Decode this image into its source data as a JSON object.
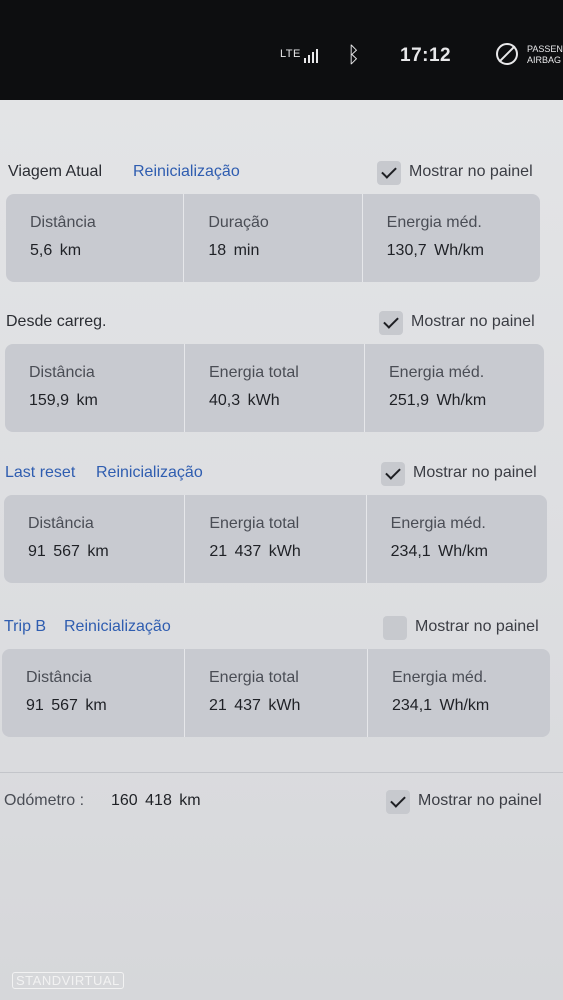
{
  "status_bar": {
    "network": "LTE",
    "bluetooth_icon": "bluetooth-icon",
    "time": "17:12",
    "airbag_text_line1": "PASSEN",
    "airbag_text_line2": "AIRBAG",
    "airbag_icon": "passenger-airbag-off-icon"
  },
  "sections": [
    {
      "title": "Viagem Atual",
      "reset": "Reinicialização",
      "checkbox_label": "Mostrar no painel",
      "checked": true,
      "cells": [
        {
          "label": "Distância",
          "value": "5,6 km"
        },
        {
          "label": "Duração",
          "value": "18 min"
        },
        {
          "label": "Energia méd.",
          "value": "130,7 Wh/km"
        }
      ]
    },
    {
      "title": "Desde carreg.",
      "checkbox_label": "Mostrar no painel",
      "checked": true,
      "cells": [
        {
          "label": "Distância",
          "value": "159,9 km"
        },
        {
          "label": "Energia total",
          "value": "40,3 kWh"
        },
        {
          "label": "Energia méd.",
          "value": "251,9 Wh/km"
        }
      ]
    },
    {
      "title": "Last reset",
      "reset": "Reinicialização",
      "checkbox_label": "Mostrar no painel",
      "checked": true,
      "cells": [
        {
          "label": "Distância",
          "value": "91 567 km"
        },
        {
          "label": "Energia total",
          "value": "21 437 kWh"
        },
        {
          "label": "Energia méd.",
          "value": "234,1 Wh/km"
        }
      ]
    },
    {
      "title": "Trip B",
      "reset": "Reinicialização",
      "checkbox_label": "Mostrar no painel",
      "checked": false,
      "cells": [
        {
          "label": "Distância",
          "value": "91 567 km"
        },
        {
          "label": "Energia total",
          "value": "21 437 kWh"
        },
        {
          "label": "Energia méd.",
          "value": "234,1 Wh/km"
        }
      ]
    }
  ],
  "odometer": {
    "label": "Odómetro :",
    "value": "160 418 km",
    "checkbox_label": "Mostrar no painel",
    "checked": true
  },
  "watermark": "STANDVIRTUAL",
  "colors": {
    "link_blue": "#2f5db0",
    "card_bg": "#c8cad0",
    "page_bg": "#e3e4e6",
    "status_bar_bg": "#0d0e10"
  }
}
